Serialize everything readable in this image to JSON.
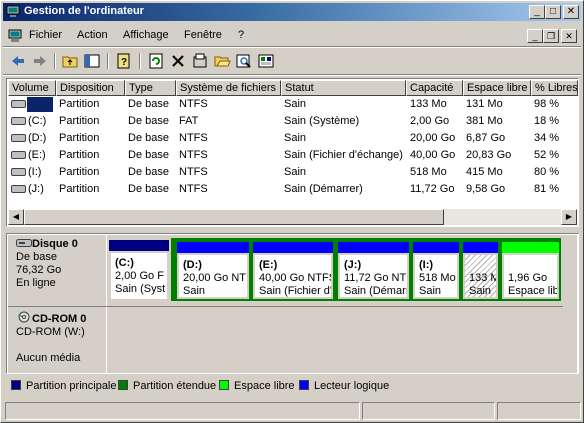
{
  "window": {
    "title": "Gestion de l'ordinateur"
  },
  "menu": [
    "Fichier",
    "Action",
    "Affichage",
    "Fenêtre",
    "?"
  ],
  "table": {
    "columns": [
      "Volume",
      "Disposition",
      "Type",
      "Système de fichiers",
      "Statut",
      "Capacité",
      "Espace libre",
      "% Libres"
    ],
    "rows": [
      [
        "",
        "Partition",
        "De base",
        "NTFS",
        "Sain",
        "133 Mo",
        "131 Mo",
        "98 %"
      ],
      [
        "(C:)",
        "Partition",
        "De base",
        "FAT",
        "Sain (Système)",
        "2,00 Go",
        "381 Mo",
        "18 %"
      ],
      [
        "(D:)",
        "Partition",
        "De base",
        "NTFS",
        "Sain",
        "20,00 Go",
        "6,87 Go",
        "34 %"
      ],
      [
        "(E:)",
        "Partition",
        "De base",
        "NTFS",
        "Sain (Fichier d'échange)",
        "40,00 Go",
        "20,83 Go",
        "52 %"
      ],
      [
        "(I:)",
        "Partition",
        "De base",
        "NTFS",
        "Sain",
        "518 Mo",
        "415 Mo",
        "80 %"
      ],
      [
        "(J:)",
        "Partition",
        "De base",
        "NTFS",
        "Sain (Démarrer)",
        "11,72 Go",
        "9,58 Go",
        "81 %"
      ]
    ]
  },
  "disk0": {
    "name": "Disque 0",
    "type": "De base",
    "size": "76,32 Go",
    "status": "En ligne",
    "partitions": [
      {
        "label": "(C:)",
        "size": "2,00 Go F",
        "status": "Sain (Syst"
      },
      {
        "label": "(D:)",
        "size": "20,00 Go NT",
        "status": "Sain"
      },
      {
        "label": "(E:)",
        "size": "40,00 Go NTFS",
        "status": "Sain (Fichier d'"
      },
      {
        "label": "(J:)",
        "size": "11,72 Go NT",
        "status": "Sain (Démarı"
      },
      {
        "label": "(I:)",
        "size": "518 Mo",
        "status": "Sain"
      },
      {
        "label": "",
        "size": "133 M",
        "status": "Sain"
      },
      {
        "label": "",
        "size": "1,96 Go",
        "status": "Espace lib"
      }
    ]
  },
  "cdrom0": {
    "name": "CD-ROM 0",
    "drive": "CD-ROM (W:)",
    "media": "Aucun média"
  },
  "legend": [
    {
      "label": "Partition principale",
      "color": "#000080"
    },
    {
      "label": "Partition étendue",
      "color": "#008000"
    },
    {
      "label": "Espace libre",
      "color": "#00ff00"
    },
    {
      "label": "Lecteur logique",
      "color": "#0000ff"
    }
  ],
  "colors": {
    "primary": "#000080",
    "extended": "#008000",
    "free": "#00ff00",
    "logical": "#0000ff"
  }
}
